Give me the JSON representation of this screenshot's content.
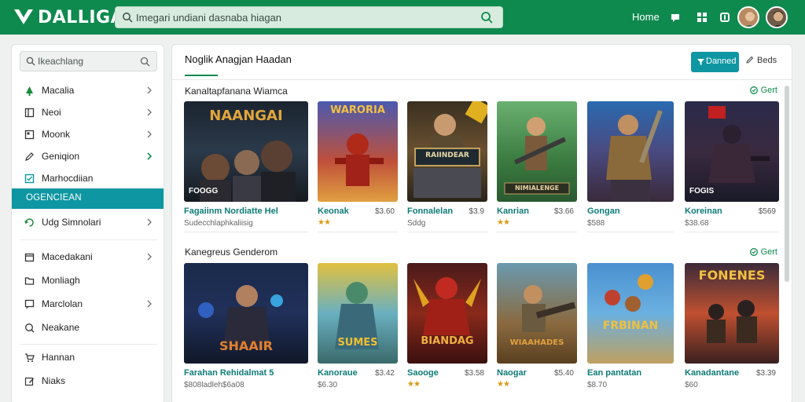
{
  "app": {
    "logo_text": "DALLIGAI",
    "search_placeholder": "Imegari undiani dasnaba hiagan",
    "home_link": "Home"
  },
  "sidebar": {
    "search_text": "Ikeachlang",
    "items": [
      {
        "label": "Macalia",
        "icon": "tree-icon"
      },
      {
        "label": "Neoi",
        "icon": "book-icon"
      },
      {
        "label": "Moonk",
        "icon": "grid-icon"
      },
      {
        "label": "Geniqion",
        "icon": "pencil-icon"
      },
      {
        "label": "Marhocdiian",
        "icon": "check-square-icon"
      },
      {
        "label": "OGENCIEAN",
        "icon": "",
        "active": true
      },
      {
        "label": "Udg Simnolari",
        "icon": "refresh-icon"
      },
      {
        "label": "Macedakani",
        "icon": "calendar-icon"
      },
      {
        "label": "Monliagh",
        "icon": "folder-icon"
      },
      {
        "label": "Marclolan",
        "icon": "chat-icon"
      },
      {
        "label": "Neakane",
        "icon": "search-icon"
      },
      {
        "label": "Hannan",
        "icon": "cart-icon"
      },
      {
        "label": "Niaks",
        "icon": "edit-icon"
      }
    ]
  },
  "main": {
    "title": "Noglik Anagjan Haadan",
    "primary_button": "Danned",
    "secondary_button": "Beds",
    "sections": [
      {
        "title": "Kanaltapfanana Wiamca",
        "link": "Gert",
        "cards": [
          {
            "art": "NAANGAI",
            "badge": "FOOGG",
            "title": "Fagaiinm Nordiatte Hel",
            "price": "",
            "sub": "Sudecchlaphkaliisig",
            "stars": ""
          },
          {
            "art": "WARORIA",
            "badge": "",
            "title": "Keonak",
            "price": "$3.60",
            "sub": "",
            "stars": "★★"
          },
          {
            "art": "RAIINDEAR",
            "badge": "",
            "title": "Fonnalelan",
            "price": "$3.9",
            "sub": "Sddg",
            "stars": ""
          },
          {
            "art": "NIMIALENGE",
            "badge": "",
            "title": "Kanrian",
            "price": "$3.66",
            "sub": "",
            "stars": "★★"
          },
          {
            "art": "",
            "badge": "",
            "title": "Gongan",
            "price": "",
            "sub": "$588",
            "stars": ""
          },
          {
            "art": "",
            "badge": "FOGIS",
            "title": "Koreinan",
            "price": "$569",
            "sub": "$38.68",
            "stars": ""
          }
        ]
      },
      {
        "title": "Kanegreus Genderom",
        "link": "Gert",
        "cards": [
          {
            "art": "SHAAIR",
            "badge": "",
            "title": "Farahan Rehidalmat 5",
            "price": "",
            "sub": "$808ladleh$6a08",
            "stars": ""
          },
          {
            "art": "SUMES",
            "badge": "",
            "title": "Kanoraue",
            "price": "$3.42",
            "sub": "$6.30",
            "stars": ""
          },
          {
            "art": "BIANDAG",
            "badge": "",
            "title": "Saooge",
            "price": "$3.58",
            "sub": "",
            "stars": "★★"
          },
          {
            "art": "WIAAHADES",
            "badge": "",
            "title": "Naogar",
            "price": "$5.40",
            "sub": "",
            "stars": "★★"
          },
          {
            "art": "FRBINAN",
            "badge": "",
            "title": "Ean pantatan",
            "price": "",
            "sub": "$8.70",
            "stars": ""
          },
          {
            "art": "FONENES",
            "badge": "",
            "title": "Kanadantane",
            "price": "$3.39",
            "sub": "$60",
            "stars": ""
          }
        ]
      }
    ]
  },
  "colors": {
    "topbar": "#0f8a4f",
    "accent": "#0e97a2",
    "link": "#0f8a4f",
    "card_title": "#0d7b77"
  }
}
